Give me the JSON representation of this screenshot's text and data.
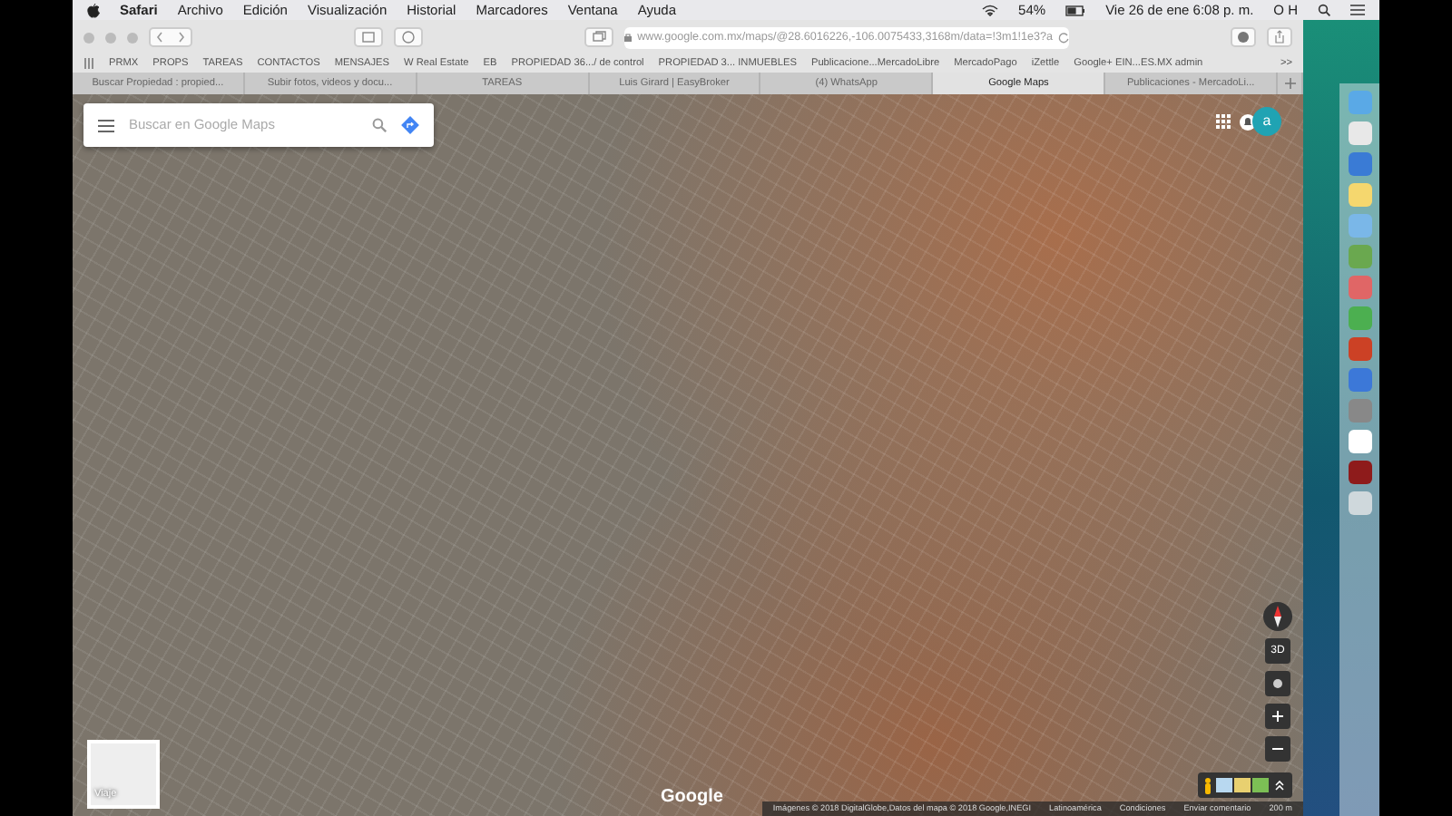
{
  "menu_bar": {
    "app": "Safari",
    "items": [
      "Archivo",
      "Edición",
      "Visualización",
      "Historial",
      "Marcadores",
      "Ventana",
      "Ayuda"
    ],
    "battery": "54%",
    "clock": "Vie 26 de ene  6:08 p. m.",
    "user": "O H"
  },
  "toolbar": {
    "url": "www.google.com.mx/maps/@28.6016226,-106.0075433,3168m/data=!3m1!1e3?a"
  },
  "bookmarks": [
    "PRMX",
    "PROPS",
    "TAREAS",
    "CONTACTOS",
    "MENSAJES",
    "W Real Estate",
    "EB",
    "PROPIEDAD 36.../ de control",
    "PROPIEDAD 3... INMUEBLES",
    "Publicacione...MercadoLibre",
    "MercadoPago",
    "iZettle",
    "Google+ EIN...ES.MX admin"
  ],
  "bookmarks_more": ">>",
  "tabs": [
    {
      "label": "Buscar Propiedad : propied...",
      "selected": false
    },
    {
      "label": "Subir fotos, videos y docu...",
      "selected": false
    },
    {
      "label": "TAREAS",
      "selected": false
    },
    {
      "label": "Luis Girard | EasyBroker",
      "selected": false
    },
    {
      "label": "(4) WhatsApp",
      "selected": false
    },
    {
      "label": "Google Maps",
      "selected": true
    },
    {
      "label": "Publicaciones - MercadoLi...",
      "selected": false
    }
  ],
  "map": {
    "search_placeholder": "Buscar en Google Maps",
    "account": "a",
    "layer_label": "Viaje",
    "control_3d": "3D",
    "logo": "Google",
    "footer": [
      "Imágenes © 2018 DigitalGlobe,Datos del mapa © 2018 Google,INEGI",
      "Latinoamérica",
      "Condiciones",
      "Enviar comentario"
    ],
    "scale": "200 m"
  }
}
